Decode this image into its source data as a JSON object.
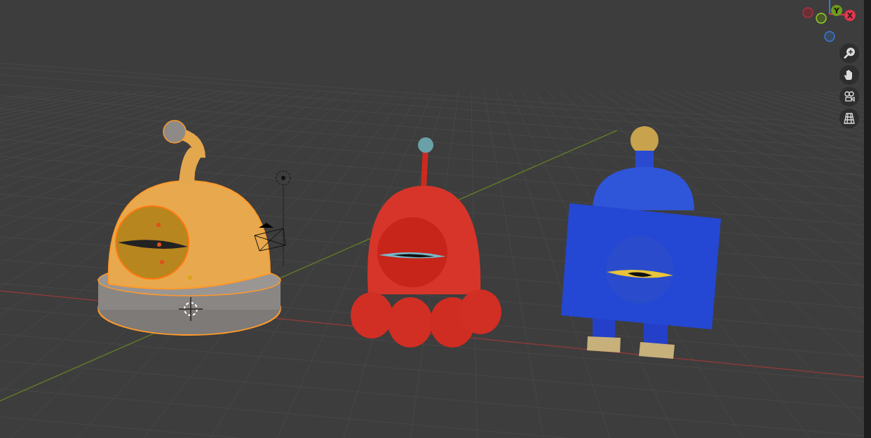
{
  "gizmo": {
    "axes": [
      {
        "label": "Y",
        "color": "#6e9a1f"
      },
      {
        "label": "X",
        "color": "#e8334d"
      }
    ]
  }
}
